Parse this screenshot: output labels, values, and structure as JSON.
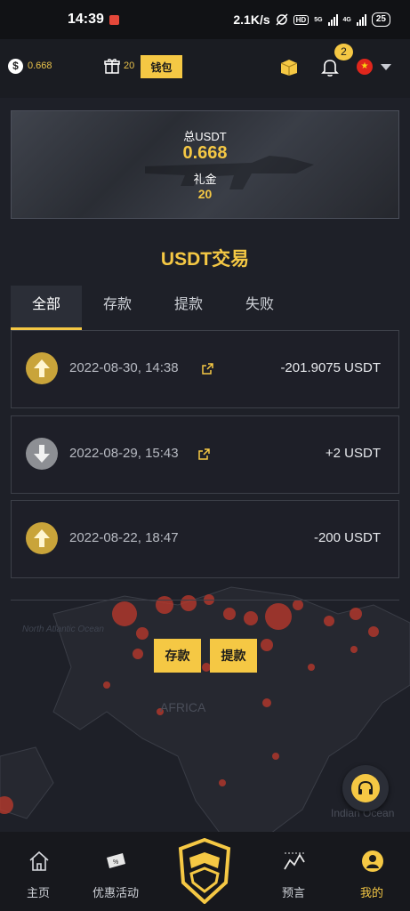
{
  "status_bar": {
    "time": "14:39",
    "speed": "2.1K/s",
    "hd": "HD",
    "net1": "5G",
    "net2": "4G",
    "battery": "25"
  },
  "topbar": {
    "balance": "0.668",
    "gift_count": "20",
    "wallet_label": "钱包",
    "notification_count": "2"
  },
  "banner": {
    "total_label": "总USDT",
    "total_value": "0.668",
    "gift_label": "礼金",
    "gift_value": "20"
  },
  "page": {
    "title": "USDT交易"
  },
  "tabs": [
    {
      "label": "全部",
      "active": true
    },
    {
      "label": "存款",
      "active": false
    },
    {
      "label": "提款",
      "active": false
    },
    {
      "label": "失败",
      "active": false
    }
  ],
  "transactions": [
    {
      "direction": "up",
      "date": "2022-08-30, 14:38",
      "amount": "-201.9075 USDT",
      "has_link": true
    },
    {
      "direction": "down",
      "date": "2022-08-29, 15:43",
      "amount": "+2 USDT",
      "has_link": true
    },
    {
      "direction": "up",
      "date": "2022-08-22, 18:47",
      "amount": "-200 USDT",
      "has_link": false
    }
  ],
  "actions": {
    "deposit_label": "存款",
    "withdraw_label": "提款"
  },
  "map_labels": {
    "atlantic": "North Atlantic Ocean",
    "africa": "AFRICA",
    "indian": "Indian Ocean"
  },
  "bottom_nav": [
    {
      "label": "主页",
      "icon": "home-icon"
    },
    {
      "label": "优惠活动",
      "icon": "ticket-icon"
    },
    {
      "label": "",
      "icon": "shield-logo-icon"
    },
    {
      "label": "预言",
      "icon": "chart-icon"
    },
    {
      "label": "我的",
      "icon": "user-icon"
    }
  ],
  "colors": {
    "accent": "#f5c844",
    "background": "#1e2028",
    "panel": "#2b2e37"
  }
}
